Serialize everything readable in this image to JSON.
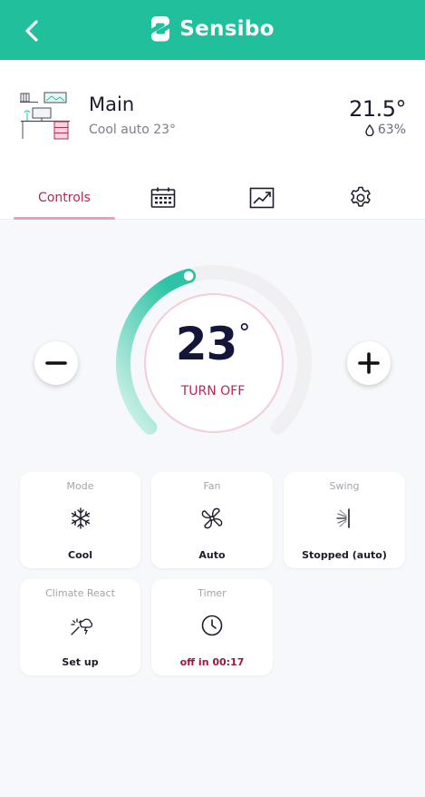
{
  "app": {
    "title": "Sensibo"
  },
  "device": {
    "name": "Main",
    "status": "Cool auto 23°",
    "temperature": "21.5°",
    "humidity": "63%"
  },
  "tabs": [
    {
      "label": "Controls",
      "icon": "controls"
    },
    {
      "label": "",
      "icon": "calendar-icon"
    },
    {
      "label": "",
      "icon": "chart-icon"
    },
    {
      "label": "",
      "icon": "gear-icon"
    }
  ],
  "thermostat": {
    "setpoint": "23",
    "degree_symbol": "°",
    "power_label": "TURN OFF",
    "level_fraction": 0.44
  },
  "cards": {
    "mode": {
      "label": "Mode",
      "value": "Cool",
      "icon": "snowflake-icon"
    },
    "fan": {
      "label": "Fan",
      "value": "Auto",
      "icon": "fan-icon"
    },
    "swing": {
      "label": "Swing",
      "value": "Stopped (auto)",
      "icon": "swing-icon"
    },
    "climate_react": {
      "label": "Climate React",
      "value": "Set up",
      "icon": "weather-icon"
    },
    "timer": {
      "label": "Timer",
      "value": "off in 00:17",
      "icon": "clock-icon"
    }
  },
  "colors": {
    "brand": "#21c09d",
    "accent": "#b02a54",
    "arc": "#34c6a9",
    "setpoint_text": "#131539"
  }
}
